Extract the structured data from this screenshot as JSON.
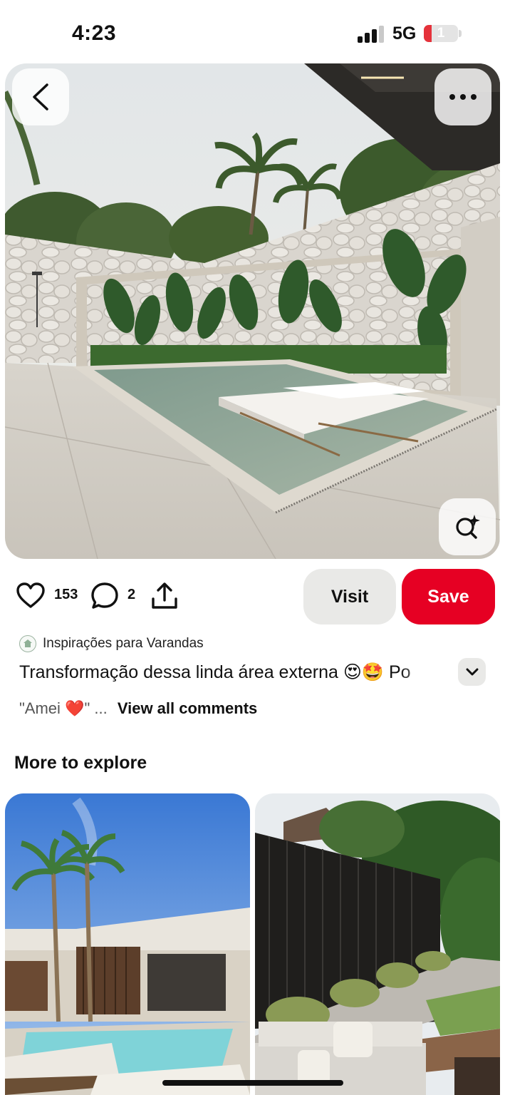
{
  "status_bar": {
    "time": "4:23",
    "network": "5G",
    "battery_level": "1",
    "signal_bars": 3
  },
  "hero": {
    "back_icon": "chevron-left-icon",
    "more_icon": "more-horizontal-icon",
    "lens_icon": "visual-search-icon"
  },
  "actions": {
    "like_count": "153",
    "comment_count": "2",
    "visit_label": "Visit",
    "save_label": "Save",
    "accent_color": "#e60023"
  },
  "pin": {
    "board_name": "Inspirações para Varandas",
    "title": "Transformação dessa linda área externa 😍🤩 Po",
    "comment_preview": "\"Amei ❤️\" ...",
    "view_all_label": "View all comments"
  },
  "explore": {
    "heading": "More to explore"
  }
}
